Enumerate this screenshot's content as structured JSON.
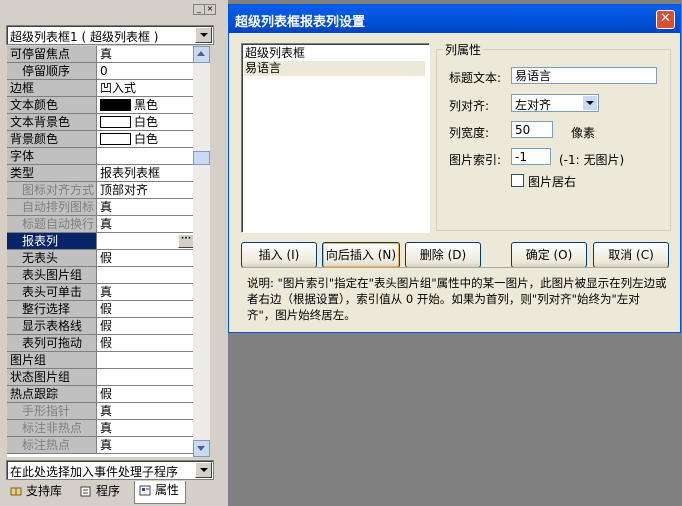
{
  "left_panel": {
    "object_selector": "超级列表框1 ( 超级列表框 )",
    "event_selector": "在此处选择加入事件处理子程序",
    "properties": [
      {
        "name": "可停留焦点",
        "value": "真"
      },
      {
        "name": "停留顺序",
        "value": "0"
      },
      {
        "name": "边框",
        "value": "凹入式"
      },
      {
        "name": "文本颜色",
        "value": "黑色",
        "swatch": "#000000"
      },
      {
        "name": "文本背景色",
        "value": "白色",
        "swatch": "#ffffff"
      },
      {
        "name": "背景颜色",
        "value": "白色",
        "swatch": "#ffffff"
      },
      {
        "name": "字体",
        "value": ""
      },
      {
        "name": "类型",
        "value": "报表列表框"
      },
      {
        "name": "图标对齐方式",
        "value": "顶部对齐"
      },
      {
        "name": "自动排列图标",
        "value": "真"
      },
      {
        "name": "标题自动换行",
        "value": "真"
      },
      {
        "name": "报表列",
        "value": ""
      },
      {
        "name": "无表头",
        "value": "假"
      },
      {
        "name": "表头图片组",
        "value": ""
      },
      {
        "name": "表头可单击",
        "value": "真"
      },
      {
        "name": "整行选择",
        "value": "假"
      },
      {
        "name": "显示表格线",
        "value": "假"
      },
      {
        "name": "表列可拖动",
        "value": "假"
      },
      {
        "name": "图片组",
        "value": ""
      },
      {
        "name": "状态图片组",
        "value": ""
      },
      {
        "name": "热点跟踪",
        "value": "假"
      },
      {
        "name": "手形指针",
        "value": "真"
      },
      {
        "name": "标注非热点",
        "value": "真"
      },
      {
        "name": "标注热点",
        "value": "真"
      }
    ],
    "tabs": [
      {
        "label": "支持库"
      },
      {
        "label": "程序"
      },
      {
        "label": "属性"
      }
    ]
  },
  "dialog": {
    "title": "超级列表框报表列设置",
    "close_glyph": "✕",
    "columns": [
      "超级列表框",
      "易语言"
    ],
    "group_title": "列属性",
    "title_text_label": "标题文本:",
    "title_text_value": "易语言",
    "align_label": "列对齐:",
    "align_value": "左对齐",
    "width_label": "列宽度:",
    "width_value": "50",
    "width_unit": "像素",
    "image_index_label": "图片索引:",
    "image_index_value": "-1",
    "image_index_hint": "(-1: 无图片)",
    "image_right_label": "图片居右",
    "buttons": {
      "insert": "插入 (I)",
      "insert_after": "向后插入 (N)",
      "delete": "删除 (D)",
      "ok": "确定 (O)",
      "cancel": "取消 (C)"
    },
    "info_text": "说明: \"图片索引\"指定在\"表头图片组\"属性中的某一图片，此图片被显示在列左边或者右边（根据设置），索引值从 0 开始。如果为首列，则\"列对齐\"始终为\"左对齐\"，图片始终居左。"
  }
}
